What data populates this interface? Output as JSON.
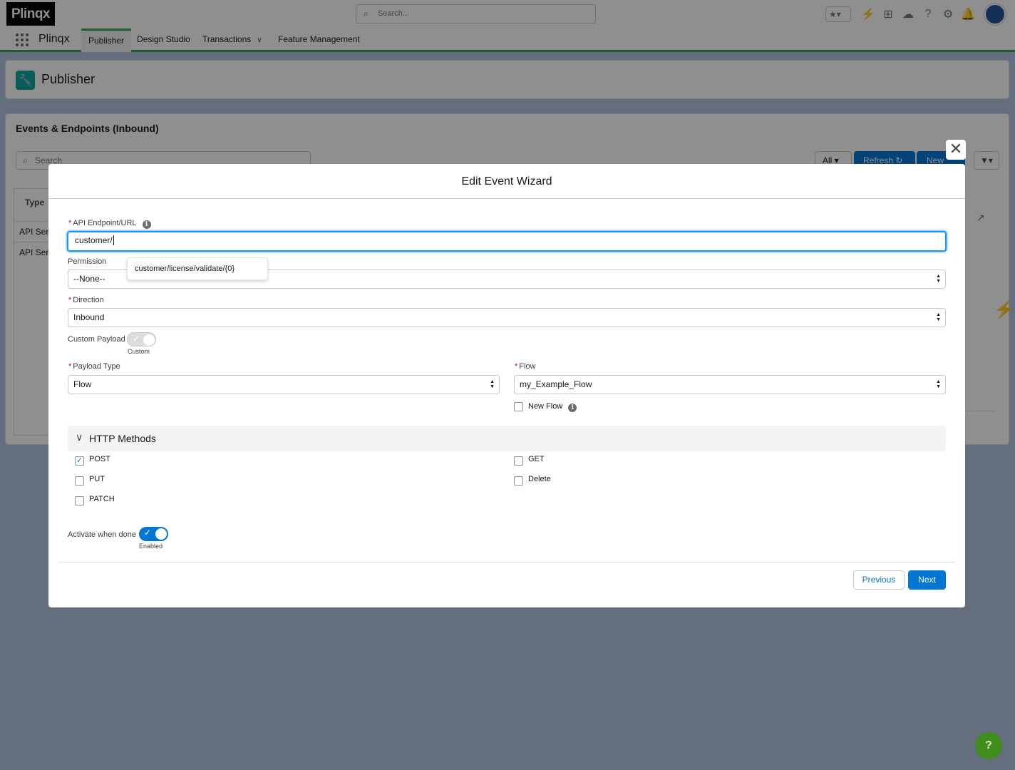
{
  "brand": {
    "logo_text": "Plinqx",
    "app_name": "Plinqx",
    "accent": "#2fa44f",
    "primary": "#0176d3"
  },
  "header": {
    "search_placeholder": "Search..."
  },
  "nav": {
    "tabs": [
      {
        "label": "Publisher",
        "active": true
      },
      {
        "label": "Design Studio"
      },
      {
        "label": "Transactions",
        "has_menu": true
      },
      {
        "label": "Feature Management"
      }
    ]
  },
  "page": {
    "title": "Publisher"
  },
  "card": {
    "title": "Events & Endpoints (Inbound)",
    "search_placeholder": "Search",
    "filter_all": "All",
    "refresh_label": "Refresh",
    "new_label": "New",
    "col_type": "Type",
    "rows": [
      "API Service",
      "API Service"
    ]
  },
  "modal": {
    "title": "Edit Event Wizard",
    "endpoint": {
      "label": "API Endpoint/URL",
      "value": "customer/",
      "suggestion": "customer/license/validate/{0}"
    },
    "permission": {
      "label": "Permission",
      "value": "--None--"
    },
    "direction": {
      "label": "Direction",
      "value": "Inbound"
    },
    "custom_payload": {
      "label": "Custom Payload",
      "state": "Custom",
      "on": false
    },
    "payload_type": {
      "label": "Payload Type",
      "value": "Flow"
    },
    "flow": {
      "label": "Flow",
      "value": "my_Example_Flow"
    },
    "new_flow": {
      "label": "New Flow",
      "checked": false
    },
    "http_methods": {
      "title": "HTTP Methods",
      "post": {
        "label": "POST",
        "checked": true
      },
      "get": {
        "label": "GET",
        "checked": false
      },
      "put": {
        "label": "PUT",
        "checked": false
      },
      "delete": {
        "label": "Delete",
        "checked": false
      },
      "patch": {
        "label": "PATCH",
        "checked": false
      }
    },
    "activate": {
      "label": "Activate when done",
      "state": "Enabled",
      "on": true
    },
    "previous_label": "Previous",
    "next_label": "Next"
  },
  "help_fab": "?"
}
